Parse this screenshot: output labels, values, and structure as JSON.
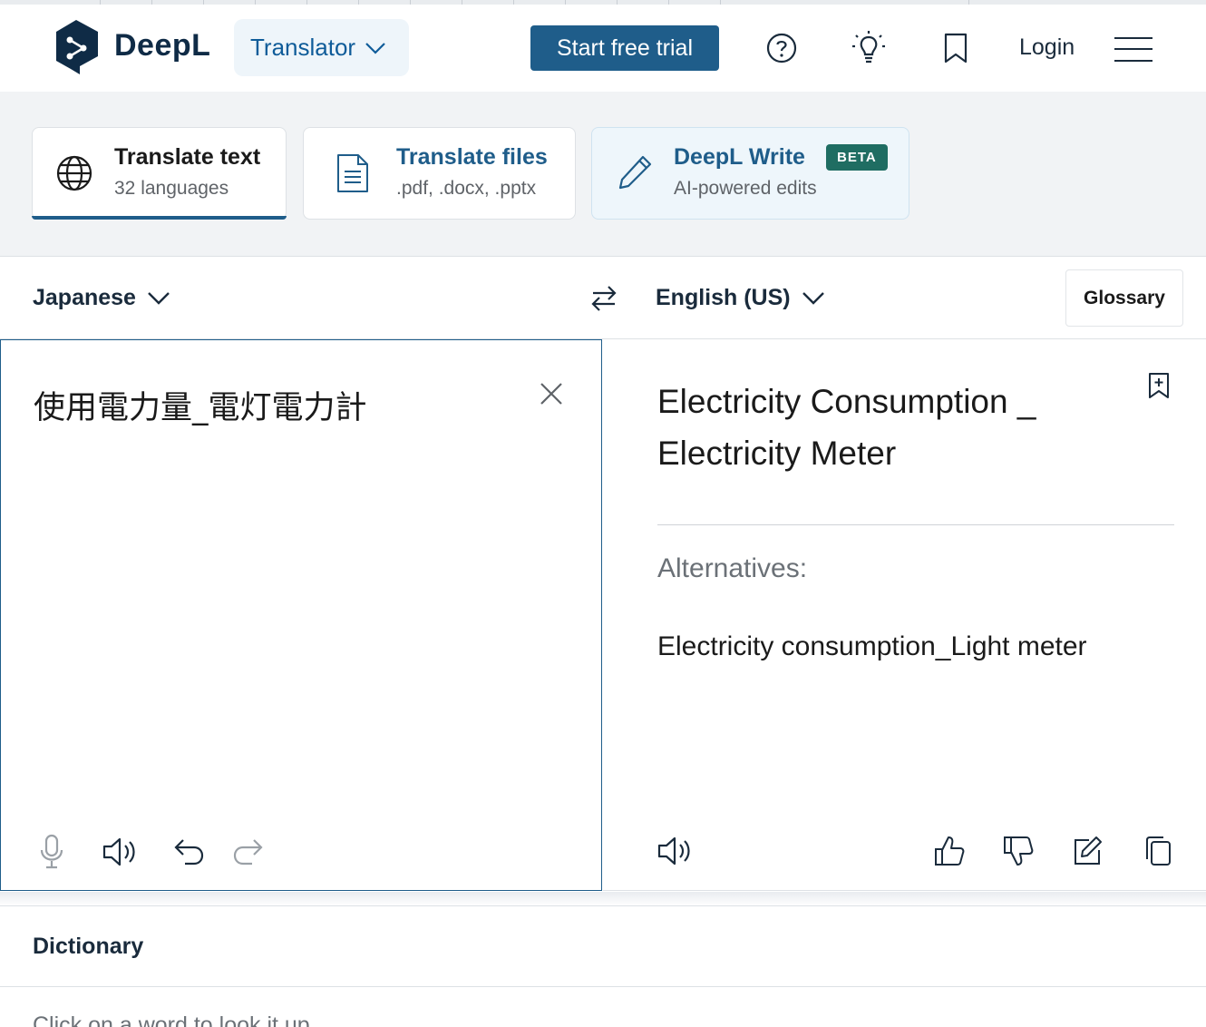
{
  "header": {
    "brand": "DeepL",
    "translator_label": "Translator",
    "trial_label": "Start free trial",
    "login_label": "Login",
    "icons": [
      "help-icon",
      "lightbulb-icon",
      "bookmark-icon",
      "menu-icon"
    ]
  },
  "tabs": [
    {
      "title": "Translate text",
      "subtitle": "32 languages"
    },
    {
      "title": "Translate files",
      "subtitle": ".pdf, .docx, .pptx"
    },
    {
      "title": "DeepL Write",
      "subtitle": "AI-powered edits",
      "badge": "BETA"
    }
  ],
  "languages": {
    "source": "Japanese",
    "target": "English (US)",
    "glossary_label": "Glossary"
  },
  "source": {
    "text": "使用電力量_電灯電力計"
  },
  "target": {
    "text": "Electricity Consumption _ Electricity Meter",
    "alternatives_label": "Alternatives:",
    "alternatives": [
      "Electricity consumption_Light meter"
    ]
  },
  "dictionary": {
    "title": "Dictionary",
    "hint": "Click on a word to look it up."
  },
  "colors": {
    "brand_navy": "#0f2b46",
    "primary_blue": "#1f5d8a",
    "beta_green": "#1f6d62"
  }
}
